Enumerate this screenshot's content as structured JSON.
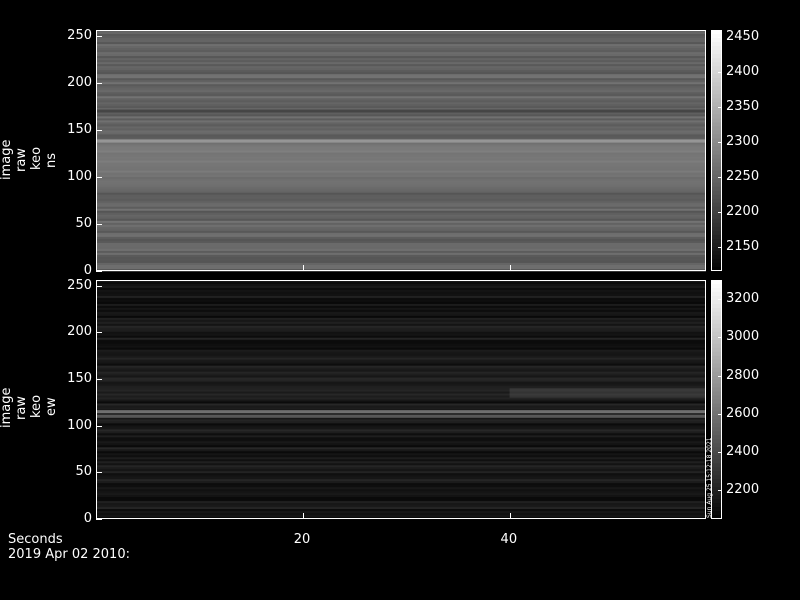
{
  "chart_data": [
    {
      "type": "heatmap",
      "ylabel_parts": [
        "image",
        "raw",
        "keo",
        "ns"
      ],
      "yticks": [
        0,
        50,
        100,
        150,
        200,
        250
      ],
      "ylim": [
        0,
        256
      ],
      "xlim": [
        0,
        59
      ],
      "colorbar_ticks": [
        2150,
        2200,
        2250,
        2300,
        2350,
        2400,
        2450
      ],
      "colorbar_range": [
        2115,
        2460
      ],
      "bright_bands": [
        {
          "y": 138,
          "value": 2330
        },
        {
          "y": 170,
          "value": 2200
        }
      ],
      "diffuse_band": {
        "y_start": 100,
        "y_end": 140,
        "value": 2310
      }
    },
    {
      "type": "heatmap",
      "ylabel_parts": [
        "image",
        "raw",
        "keo",
        "ew"
      ],
      "yticks": [
        0,
        50,
        100,
        150,
        200,
        250
      ],
      "ylim": [
        0,
        256
      ],
      "xlim": [
        0,
        59
      ],
      "colorbar_ticks": [
        2200,
        2400,
        2600,
        2800,
        3000,
        3200
      ],
      "colorbar_range": [
        2050,
        3300
      ],
      "bright_bands": [
        {
          "y": 115,
          "value": 2700
        },
        {
          "y": 110,
          "value": 2550
        }
      ],
      "diffuse_band": {
        "y_start": 130,
        "y_end": 140,
        "x_start": 40,
        "value": 2450
      },
      "stamp": "Sun Aug 25 15:12:18 2021"
    }
  ],
  "xaxis": {
    "label": "Seconds",
    "ticks": [
      20,
      40
    ]
  },
  "footer": {
    "date": "2019 Apr 02 2010:"
  }
}
